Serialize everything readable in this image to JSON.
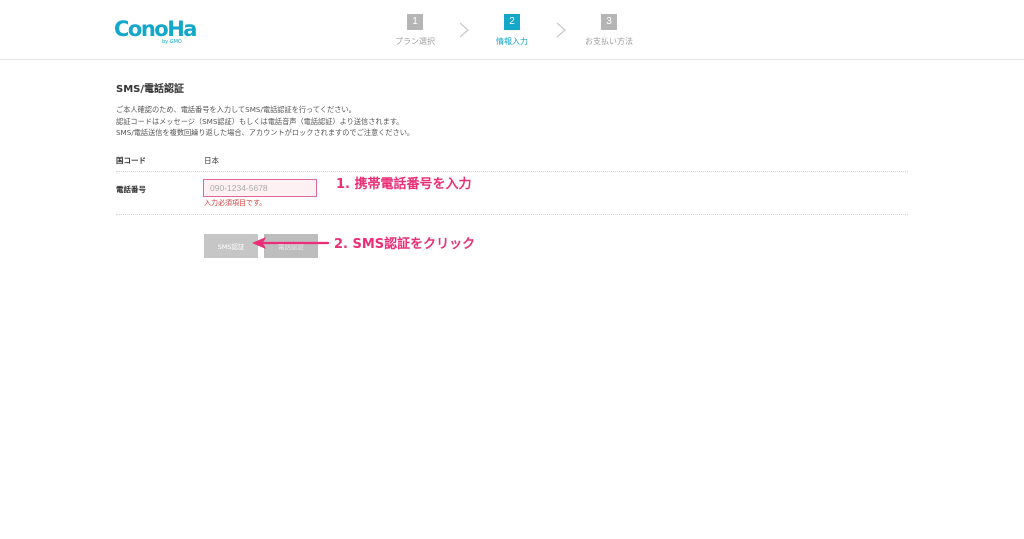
{
  "header": {
    "brand_colors": {
      "logo": "#13a8c9",
      "active_step": "#14a7c8",
      "inactive_step": "#b5b5b5"
    },
    "steps": [
      {
        "number": "1",
        "label": "プラン選択",
        "active": false
      },
      {
        "number": "2",
        "label": "情報入力",
        "active": true
      },
      {
        "number": "3",
        "label": "お支払い方法",
        "active": false
      }
    ]
  },
  "section": {
    "title": "SMS/電話認証",
    "description": [
      "ご本人確認のため、電話番号を入力してSMS/電話認証を行ってください。",
      "認証コードはメッセージ（SMS認証）もしくは電話音声（電話認証）より送信されます。",
      "SMS/電話送信を複数回繰り返した場合、アカウントがロックされますのでご注意ください。"
    ]
  },
  "form": {
    "country_label": "国コード",
    "country_value": "日本",
    "phone_label": "電話番号",
    "phone_placeholder": "090-1234-5678",
    "phone_value": "",
    "error_text": "入力必須項目です。",
    "error_color": "#d13a3a",
    "sms_button": "SMS認証",
    "voice_button": "電話認証"
  },
  "annotations": {
    "color": "#ea2e77",
    "step1": "1. 携帯電話番号を入力",
    "step2": "2. SMS認証をクリック"
  }
}
